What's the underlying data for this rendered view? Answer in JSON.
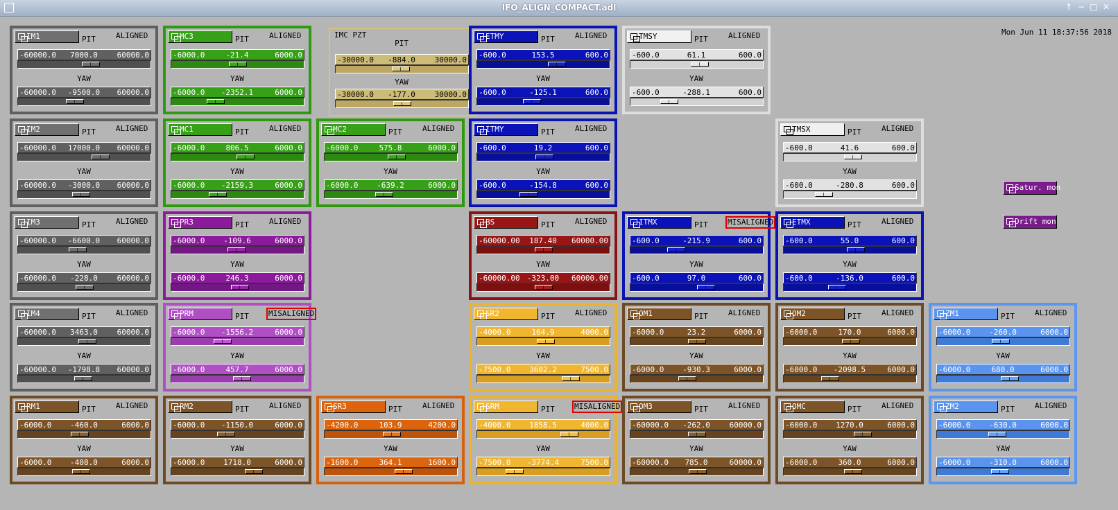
{
  "window": {
    "title": "IFO_ALIGN_COMPACT.adl",
    "controls": [
      "↑",
      "−",
      "□",
      "✕"
    ]
  },
  "datetime": "Mon Jun 11 18:37:56 2018",
  "labels": {
    "pit": "PIT",
    "yaw": "YAW"
  },
  "buttons": {
    "satur": "Satur. mon",
    "drift": "Drift mon"
  },
  "imcpzt": {
    "name": "IMC PZT",
    "pit": "PIT",
    "yaw": "YAW",
    "pit_min": "-30000.0",
    "pit_val": "-884.0",
    "pit_max": "30000.0",
    "pit_pos": 0.49,
    "yaw_min": "-30000.0",
    "yaw_val": "-177.0",
    "yaw_max": "30000.0",
    "yaw_pos": 0.5
  },
  "colors": {
    "gray": {
      "border": "#5f5f5f",
      "bg": "#707070",
      "row": "#606060",
      "slider": "#505050",
      "knob": "#6e6e6e",
      "cap": "#707070",
      "text": "#ffffff"
    },
    "green": {
      "border": "#2f9a10",
      "bg": "#36a016",
      "row": "#36a016",
      "slider": "#2c8a10",
      "knob": "#3aa81a",
      "cap": "#36a016",
      "text": "#ffffff"
    },
    "blue": {
      "border": "#0a14b4",
      "bg": "#0a12b8",
      "row": "#0a12b8",
      "slider": "#08109a",
      "knob": "#1520c8",
      "cap": "#0a12b8",
      "text": "#ffffff"
    },
    "white": {
      "border": "#dddddd",
      "bg": "#e2e2e2",
      "row": "#e2e2e2",
      "slider": "#d2d2d2",
      "knob": "#e6e6e6",
      "cap": "#f0f0f0",
      "text": "#000000"
    },
    "purple": {
      "border": "#8c1c9c",
      "bg": "#8c1a9c",
      "row": "#8c1a9c",
      "slider": "#741686",
      "knob": "#9a24ac",
      "cap": "#8c1a9c",
      "text": "#ffffff"
    },
    "lpurple": {
      "border": "#b04ec4",
      "bg": "#b04ec4",
      "row": "#b04ec4",
      "slider": "#9a3eae",
      "knob": "#bc5ccf",
      "cap": "#b04ec4",
      "text": "#ffffff"
    },
    "red": {
      "border": "#8a1414",
      "bg": "#981616",
      "row": "#981616",
      "slider": "#7a1010",
      "knob": "#a41c1c",
      "cap": "#981616",
      "text": "#ffffff"
    },
    "yellow": {
      "border": "#ecb42c",
      "bg": "#f0b630",
      "row": "#f0b630",
      "slider": "#d89e20",
      "knob": "#f4c040",
      "cap": "#f0b630",
      "text": "#ffffff"
    },
    "brown": {
      "border": "#6e4a24",
      "bg": "#7c5428",
      "row": "#7c5428",
      "slider": "#664420",
      "knob": "#86602e",
      "cap": "#7c5428",
      "text": "#ffffff"
    },
    "orange": {
      "border": "#d6600c",
      "bg": "#dc640c",
      "row": "#dc640c",
      "slider": "#be540a",
      "knob": "#e87418",
      "cap": "#dc640c",
      "text": "#ffffff"
    },
    "lblue": {
      "border": "#5a96f0",
      "bg": "#5a94ee",
      "row": "#5a94ee",
      "slider": "#3e7ad6",
      "knob": "#66a2f6",
      "cap": "#5a94ee",
      "text": "#ffffff"
    },
    "imc": {
      "border": "#d6c47c",
      "bg": "#ccbc78",
      "row": "#ccbc78",
      "slider": "#bca862",
      "knob": "#d8c886",
      "cap": "#ccbc78",
      "text": "#000000"
    }
  },
  "panels": [
    {
      "id": "im1",
      "name": "IM1",
      "theme": "gray",
      "col": 0,
      "row": 0,
      "status": "ALIGNED",
      "pit": {
        "min": "-60000.0",
        "val": "7000.0",
        "max": "60000.0",
        "pos": 0.56
      },
      "yaw": {
        "min": "-60000.0",
        "val": "-9500.0",
        "max": "60000.0",
        "pos": 0.42
      }
    },
    {
      "id": "mc3",
      "name": "MC3",
      "theme": "green",
      "col": 1,
      "row": 0,
      "status": "ALIGNED",
      "pit": {
        "min": "-6000.0",
        "val": "-21.4",
        "max": "6000.0",
        "pos": 0.5
      },
      "yaw": {
        "min": "-6000.0",
        "val": "-2352.1",
        "max": "6000.0",
        "pos": 0.31
      }
    },
    {
      "id": "etmy",
      "name": "ETMY",
      "theme": "blue",
      "col": 3,
      "row": 0,
      "status": "ALIGNED",
      "pit": {
        "min": "-600.0",
        "val": "153.5",
        "max": "600.0",
        "pos": 0.62
      },
      "yaw": {
        "min": "-600.0",
        "val": "-125.1",
        "max": "600.0",
        "pos": 0.4
      }
    },
    {
      "id": "tmsy",
      "name": "TMSY",
      "theme": "white",
      "col": 4,
      "row": 0,
      "status": "ALIGNED",
      "pit": {
        "min": "-600.0",
        "val": "61.1",
        "max": "600.0",
        "pos": 0.53
      },
      "yaw": {
        "min": "-600.0",
        "val": "-288.1",
        "max": "600.0",
        "pos": 0.26
      }
    },
    {
      "id": "im2",
      "name": "IM2",
      "theme": "gray",
      "col": 0,
      "row": 1,
      "status": "ALIGNED",
      "pit": {
        "min": "-60000.0",
        "val": "17000.0",
        "max": "60000.0",
        "pos": 0.64
      },
      "yaw": {
        "min": "-60000.0",
        "val": "-3000.0",
        "max": "60000.0",
        "pos": 0.47
      }
    },
    {
      "id": "mc1",
      "name": "MC1",
      "theme": "green",
      "col": 1,
      "row": 1,
      "status": "ALIGNED",
      "pit": {
        "min": "-6000.0",
        "val": "806.5",
        "max": "6000.0",
        "pos": 0.57
      },
      "yaw": {
        "min": "-6000.0",
        "val": "-2159.3",
        "max": "6000.0",
        "pos": 0.33
      }
    },
    {
      "id": "mc2",
      "name": "MC2",
      "theme": "green",
      "col": 2,
      "row": 1,
      "status": "ALIGNED",
      "pit": {
        "min": "-6000.0",
        "val": "575.8",
        "max": "6000.0",
        "pos": 0.55
      },
      "yaw": {
        "min": "-6000.0",
        "val": "-639.2",
        "max": "6000.0",
        "pos": 0.44
      }
    },
    {
      "id": "itmy",
      "name": "ITMY",
      "theme": "blue",
      "col": 3,
      "row": 1,
      "status": "ALIGNED",
      "pit": {
        "min": "-600.0",
        "val": "19.2",
        "max": "600.0",
        "pos": 0.51
      },
      "yaw": {
        "min": "-600.0",
        "val": "-154.8",
        "max": "600.0",
        "pos": 0.37
      }
    },
    {
      "id": "tmsx",
      "name": "TMSX",
      "theme": "white",
      "col": 5,
      "row": 1,
      "status": "ALIGNED",
      "pit": {
        "min": "-600.0",
        "val": "41.6",
        "max": "600.0",
        "pos": 0.53
      },
      "yaw": {
        "min": "-600.0",
        "val": "-280.8",
        "max": "600.0",
        "pos": 0.27
      }
    },
    {
      "id": "im3",
      "name": "IM3",
      "theme": "gray",
      "col": 0,
      "row": 2,
      "status": "ALIGNED",
      "pit": {
        "min": "-60000.0",
        "val": "-6600.0",
        "max": "60000.0",
        "pos": 0.44
      },
      "yaw": {
        "min": "-60000.0",
        "val": "-228.0",
        "max": "60000.0",
        "pos": 0.5
      }
    },
    {
      "id": "pr3",
      "name": "PR3",
      "theme": "purple",
      "col": 1,
      "row": 2,
      "status": "ALIGNED",
      "pit": {
        "min": "-6000.0",
        "val": "-109.6",
        "max": "6000.0",
        "pos": 0.49
      },
      "yaw": {
        "min": "-6000.0",
        "val": "246.3",
        "max": "6000.0",
        "pos": 0.52
      }
    },
    {
      "id": "bs",
      "name": "BS",
      "theme": "red",
      "col": 3,
      "row": 2,
      "status": "ALIGNED",
      "pit": {
        "min": "-60000.00",
        "val": "187.40",
        "max": "60000.00",
        "pos": 0.5
      },
      "yaw": {
        "min": "-60000.00",
        "val": "-323.00",
        "max": "60000.00",
        "pos": 0.5
      }
    },
    {
      "id": "itmx",
      "name": "ITMX",
      "theme": "blue",
      "col": 4,
      "row": 2,
      "status": "MISALIGNED",
      "pit": {
        "min": "-600.0",
        "val": "-215.9",
        "max": "600.0",
        "pos": 0.32
      },
      "yaw": {
        "min": "-600.0",
        "val": "97.0",
        "max": "600.0",
        "pos": 0.58
      }
    },
    {
      "id": "etmx",
      "name": "ETMX",
      "theme": "blue",
      "col": 5,
      "row": 2,
      "status": "ALIGNED",
      "pit": {
        "min": "-600.0",
        "val": "55.0",
        "max": "600.0",
        "pos": 0.55
      },
      "yaw": {
        "min": "-600.0",
        "val": "-136.0",
        "max": "600.0",
        "pos": 0.39
      }
    },
    {
      "id": "im4",
      "name": "IM4",
      "theme": "gray",
      "col": 0,
      "row": 3,
      "status": "ALIGNED",
      "pit": {
        "min": "-60000.0",
        "val": "3463.0",
        "max": "60000.0",
        "pos": 0.53
      },
      "yaw": {
        "min": "-60000.0",
        "val": "-1798.8",
        "max": "60000.0",
        "pos": 0.49
      }
    },
    {
      "id": "prm",
      "name": "PRM",
      "theme": "lpurple",
      "col": 1,
      "row": 3,
      "status": "MISALIGNED",
      "pit": {
        "min": "-6000.0",
        "val": "-1556.2",
        "max": "6000.0",
        "pos": 0.37
      },
      "yaw": {
        "min": "-6000.0",
        "val": "457.7",
        "max": "6000.0",
        "pos": 0.54
      }
    },
    {
      "id": "sr2",
      "name": "SR2",
      "theme": "yellow",
      "col": 3,
      "row": 3,
      "status": "ALIGNED",
      "pit": {
        "min": "-4000.0",
        "val": "164.9",
        "max": "4000.0",
        "pos": 0.52
      },
      "yaw": {
        "min": "-7500.0",
        "val": "3602.2",
        "max": "7500.0",
        "pos": 0.74
      }
    },
    {
      "id": "om1",
      "name": "OM1",
      "theme": "brown",
      "col": 4,
      "row": 3,
      "status": "ALIGNED",
      "pit": {
        "min": "-6000.0",
        "val": "23.2",
        "max": "6000.0",
        "pos": 0.5
      },
      "yaw": {
        "min": "-6000.0",
        "val": "-930.3",
        "max": "6000.0",
        "pos": 0.42
      }
    },
    {
      "id": "om2",
      "name": "OM2",
      "theme": "brown",
      "col": 5,
      "row": 3,
      "status": "ALIGNED",
      "pit": {
        "min": "-6000.0",
        "val": "170.0",
        "max": "6000.0",
        "pos": 0.51
      },
      "yaw": {
        "min": "-6000.0",
        "val": "-2098.5",
        "max": "6000.0",
        "pos": 0.33
      }
    },
    {
      "id": "zm1",
      "name": "ZM1",
      "theme": "lblue",
      "col": 6,
      "row": 3,
      "status": "ALIGNED",
      "pit": {
        "min": "-6000.0",
        "val": "-260.0",
        "max": "6000.0",
        "pos": 0.48
      },
      "yaw": {
        "min": "-6000.0",
        "val": "680.0",
        "max": "6000.0",
        "pos": 0.56
      }
    },
    {
      "id": "rm1",
      "name": "RM1",
      "theme": "brown",
      "col": 0,
      "row": 4,
      "status": "ALIGNED",
      "pit": {
        "min": "-6000.0",
        "val": "-460.0",
        "max": "6000.0",
        "pos": 0.46
      },
      "yaw": {
        "min": "-6000.0",
        "val": "-408.0",
        "max": "6000.0",
        "pos": 0.47
      }
    },
    {
      "id": "rm2",
      "name": "RM2",
      "theme": "brown",
      "col": 1,
      "row": 4,
      "status": "ALIGNED",
      "pit": {
        "min": "-6000.0",
        "val": "-1150.0",
        "max": "6000.0",
        "pos": 0.4
      },
      "yaw": {
        "min": "-6000.0",
        "val": "1718.0",
        "max": "6000.0",
        "pos": 0.64
      }
    },
    {
      "id": "sr3",
      "name": "SR3",
      "theme": "orange",
      "col": 2,
      "row": 4,
      "status": "ALIGNED",
      "pit": {
        "min": "-4200.0",
        "val": "103.9",
        "max": "4200.0",
        "pos": 0.51
      },
      "yaw": {
        "min": "-1600.0",
        "val": "364.1",
        "max": "1600.0",
        "pos": 0.61
      }
    },
    {
      "id": "srm",
      "name": "SRM",
      "theme": "yellow",
      "col": 3,
      "row": 4,
      "status": "MISALIGNED",
      "pit": {
        "min": "-4000.0",
        "val": "1858.5",
        "max": "4000.0",
        "pos": 0.73
      },
      "yaw": {
        "min": "-7500.0",
        "val": "-3774.4",
        "max": "7500.0",
        "pos": 0.25
      }
    },
    {
      "id": "om3",
      "name": "OM3",
      "theme": "brown",
      "col": 4,
      "row": 4,
      "status": "ALIGNED",
      "pit": {
        "min": "-60000.0",
        "val": "-262.0",
        "max": "60000.0",
        "pos": 0.5
      },
      "yaw": {
        "min": "-60000.0",
        "val": "785.0",
        "max": "60000.0",
        "pos": 0.51
      }
    },
    {
      "id": "omc",
      "name": "OMC",
      "theme": "brown",
      "col": 5,
      "row": 4,
      "status": "ALIGNED",
      "pit": {
        "min": "-6000.0",
        "val": "1270.0",
        "max": "6000.0",
        "pos": 0.61
      },
      "yaw": {
        "min": "-6000.0",
        "val": "360.0",
        "max": "6000.0",
        "pos": 0.53
      }
    },
    {
      "id": "zm2",
      "name": "ZM2",
      "theme": "lblue",
      "col": 6,
      "row": 4,
      "status": "ALIGNED",
      "pit": {
        "min": "-6000.0",
        "val": "-630.0",
        "max": "6000.0",
        "pos": 0.45
      },
      "yaw": {
        "min": "-6000.0",
        "val": "-310.0",
        "max": "6000.0",
        "pos": 0.47
      }
    }
  ]
}
